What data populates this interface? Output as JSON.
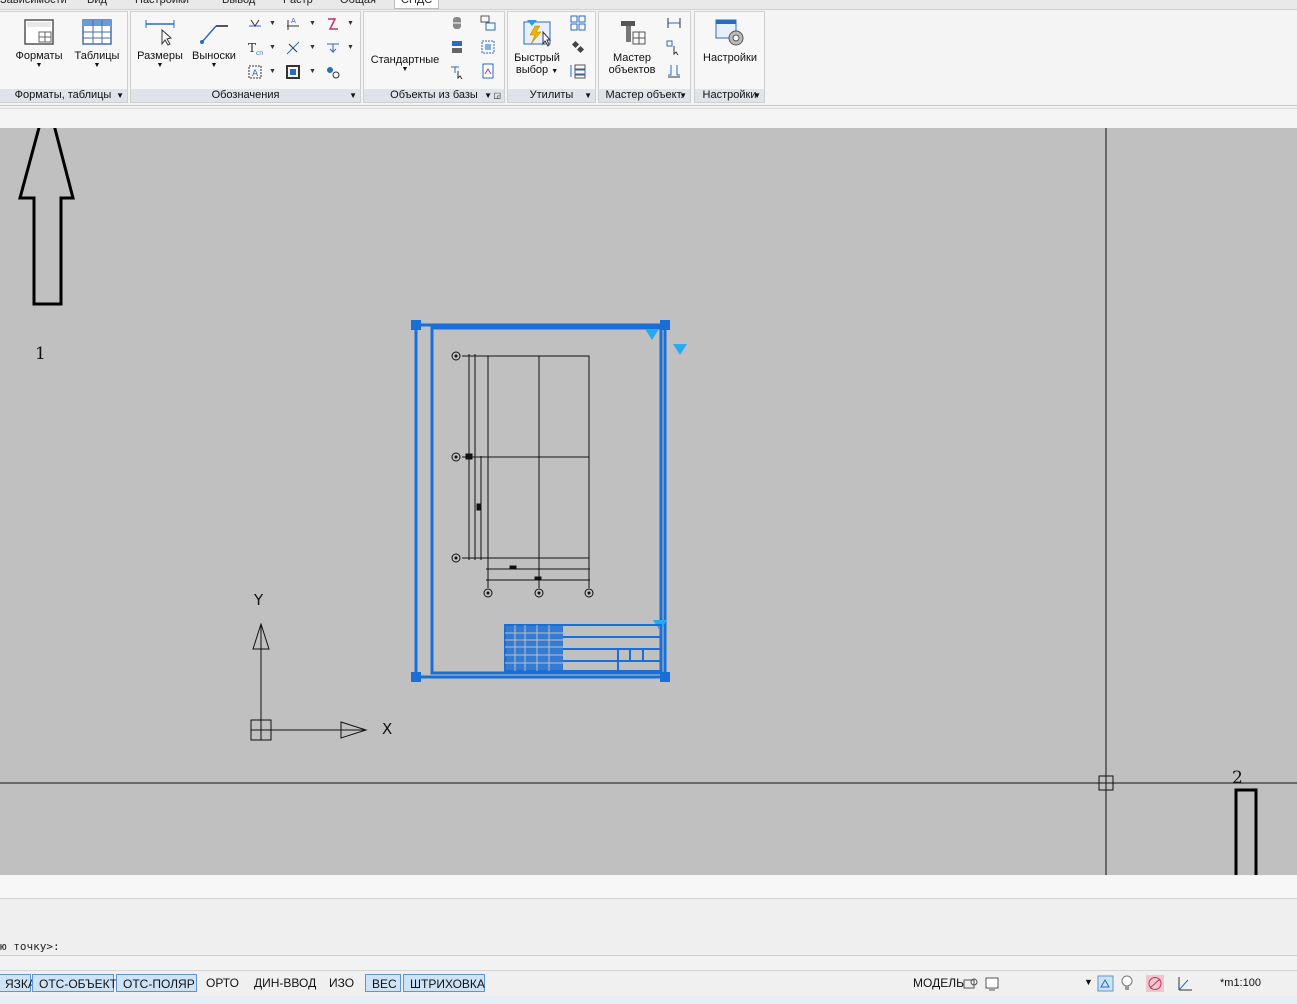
{
  "tabs": [
    {
      "label": "Зависимости"
    },
    {
      "label": "Вид"
    },
    {
      "label": "Настройки"
    },
    {
      "label": "Вывод"
    },
    {
      "label": "Растр"
    },
    {
      "label": "Общая"
    },
    {
      "label": "СПДС"
    }
  ],
  "ribbon": {
    "panels": {
      "formats": {
        "title": "Форматы, таблицы",
        "buttons": [
          "Форматы",
          "Таблицы"
        ]
      },
      "designations": {
        "title": "Обозначения",
        "buttons": [
          "Размеры",
          "Выноски"
        ]
      },
      "objects_db": {
        "title": "Объекты из базы",
        "buttons": [
          "Стандартные"
        ]
      },
      "utilities": {
        "title": "Утилиты",
        "buttons": [
          "Быстрый",
          "выбор"
        ]
      },
      "wizard": {
        "title": "Мастер объект.",
        "buttons": [
          "Мастер",
          "объектов"
        ]
      },
      "settings": {
        "title": "Настройки",
        "buttons": [
          "Настройки"
        ]
      }
    }
  },
  "ucs": {
    "x_label": "X",
    "y_label": "Y"
  },
  "annotations": {
    "label1": "1",
    "label2": "2"
  },
  "command_line": {
    "prompt": "ю точку>:"
  },
  "statusbar": {
    "buttons": [
      {
        "label": "ЯЗКА",
        "on": true
      },
      {
        "label": "ОТС-ОБЪЕКТ",
        "on": true
      },
      {
        "label": "ОТС-ПОЛЯР",
        "on": true
      },
      {
        "label": "ОРТО",
        "on": false
      },
      {
        "label": "ДИН-ВВОД",
        "on": false
      },
      {
        "label": "ИЗО",
        "on": false
      },
      {
        "label": "ВЕС",
        "on": true
      },
      {
        "label": "ШТРИХОВКА",
        "on": true
      }
    ],
    "model": "МОДЕЛЬ",
    "scale": "*m1:100"
  },
  "colors": {
    "selection": "#1a6fd6",
    "canvas": "#c0c0c0",
    "status_on": "#cfe3f7"
  }
}
